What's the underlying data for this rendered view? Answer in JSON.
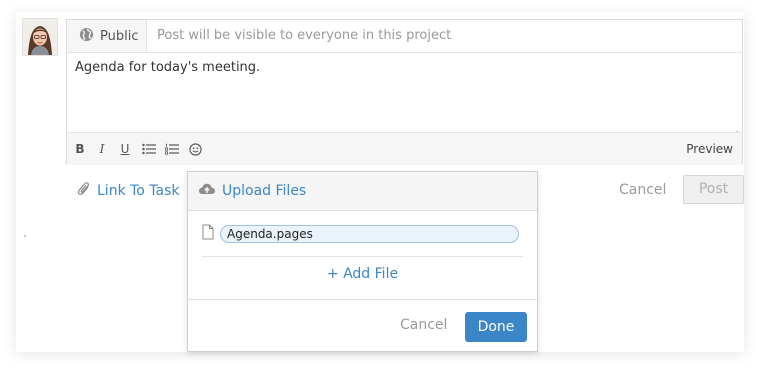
{
  "composer": {
    "visibility_label": "Public",
    "visibility_hint": "Post will be visible to everyone in this project",
    "text": "Agenda for today's meeting.",
    "toolbar": {
      "bold": "B",
      "italic": "I",
      "underline": "U",
      "preview_label": "Preview"
    }
  },
  "actions": {
    "link_task_label": "Link To Task",
    "cancel_label": "Cancel",
    "post_label": "Post"
  },
  "upload": {
    "title": "Upload Files",
    "files": [
      "Agenda.pages"
    ],
    "add_file_label": "+ Add File",
    "cancel_label": "Cancel",
    "done_label": "Done"
  },
  "icons": {
    "visibility": "globe-icon",
    "link": "paperclip-icon",
    "upload": "cloud-upload-icon",
    "file": "document-icon"
  },
  "colors": {
    "accent": "#3b86c5",
    "done_button": "#3b86c9"
  }
}
